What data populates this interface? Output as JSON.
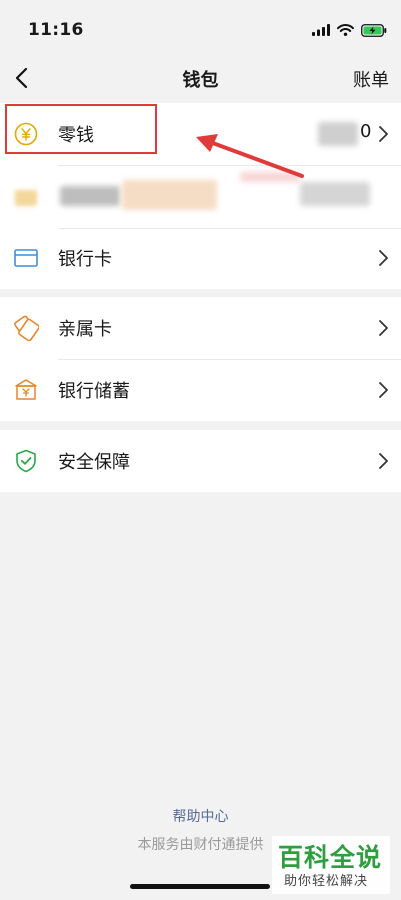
{
  "status_bar": {
    "time": "11:16",
    "icons": [
      "signal-icon",
      "wifi-icon",
      "battery-charging-icon"
    ],
    "battery_color": "#34c759"
  },
  "nav": {
    "back_icon": "chevron-left-icon",
    "title": "钱包",
    "right_label": "账单"
  },
  "menu": {
    "group1": [
      {
        "label": "零钱",
        "icon": "yuan-coin-icon",
        "value": "0"
      },
      {
        "label": "",
        "icon": "folder-icon",
        "value": ""
      },
      {
        "label": "银行卡",
        "icon": "bank-card-icon",
        "value": ""
      }
    ],
    "group2": [
      {
        "label": "亲属卡",
        "icon": "family-card-icon"
      },
      {
        "label": "银行储蓄",
        "icon": "bank-savings-icon"
      }
    ],
    "group3": [
      {
        "label": "安全保障",
        "icon": "shield-check-icon"
      }
    ]
  },
  "footer": {
    "help_link": "帮助中心",
    "note": "本服务由财付通提供"
  },
  "watermark": {
    "title": "百科全说",
    "subtitle": "助你轻松解决"
  },
  "colors": {
    "accent_link": "#576b95",
    "annotation_red": "#e03a3a",
    "coin_yellow": "#e6a800",
    "card_blue": "#3d8fd6",
    "orange_icon": "#e8862a",
    "shield_green": "#2aa84a"
  }
}
